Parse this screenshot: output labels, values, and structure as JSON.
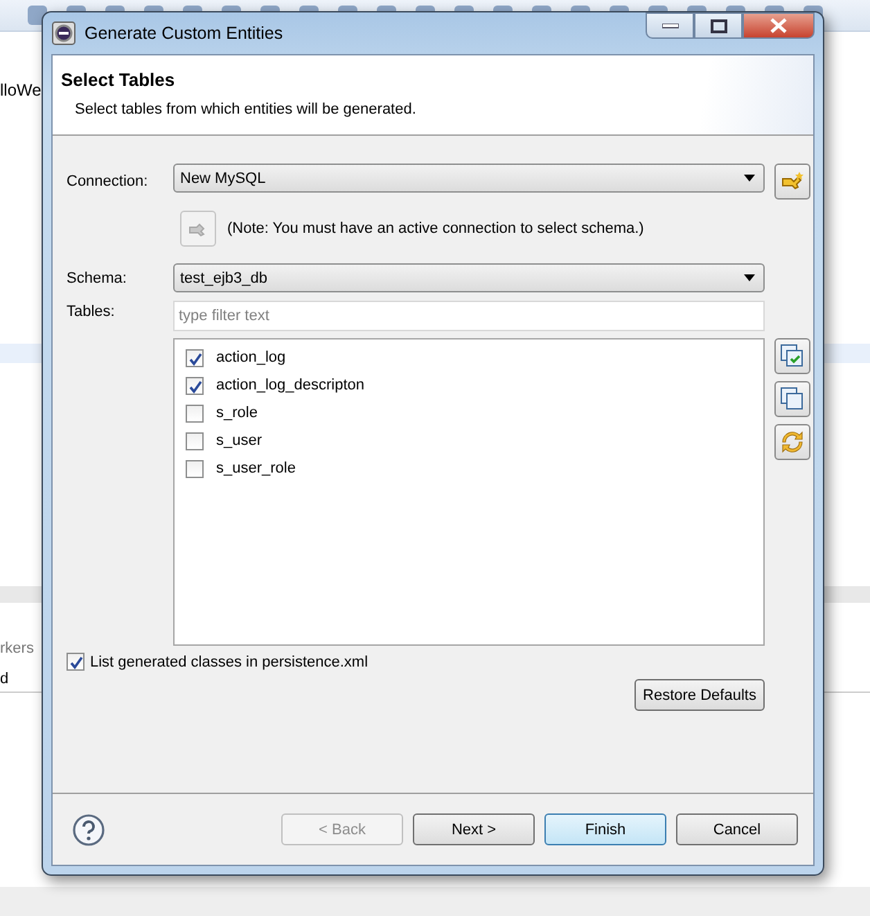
{
  "background": {
    "editor_tab": "lloWe",
    "view_tab": "rkers",
    "view_row": "d"
  },
  "window": {
    "title": "Generate Custom Entities"
  },
  "header": {
    "title": "Select Tables",
    "description": "Select tables from which entities will be generated."
  },
  "connection": {
    "label": "Connection:",
    "value": "New MySQL"
  },
  "note": "(Note: You must have an active connection to select schema.)",
  "schema": {
    "label": "Schema:",
    "value": "test_ejb3_db"
  },
  "tables": {
    "label": "Tables:",
    "placeholder": "type filter text",
    "items": [
      {
        "name": "action_log",
        "checked": true
      },
      {
        "name": "action_log_descripton",
        "checked": true
      },
      {
        "name": "s_role",
        "checked": false
      },
      {
        "name": "s_user",
        "checked": false
      },
      {
        "name": "s_user_role",
        "checked": false
      }
    ]
  },
  "list_generated": {
    "label": "List generated classes in persistence.xml",
    "checked": true
  },
  "restore_button": "Restore Defaults",
  "buttons": [
    {
      "label": "< Back",
      "disabled": true,
      "default": false
    },
    {
      "label": "Next >",
      "disabled": false,
      "default": false
    },
    {
      "label": "Finish",
      "disabled": false,
      "default": true
    },
    {
      "label": "Cancel",
      "disabled": false,
      "default": false
    }
  ]
}
